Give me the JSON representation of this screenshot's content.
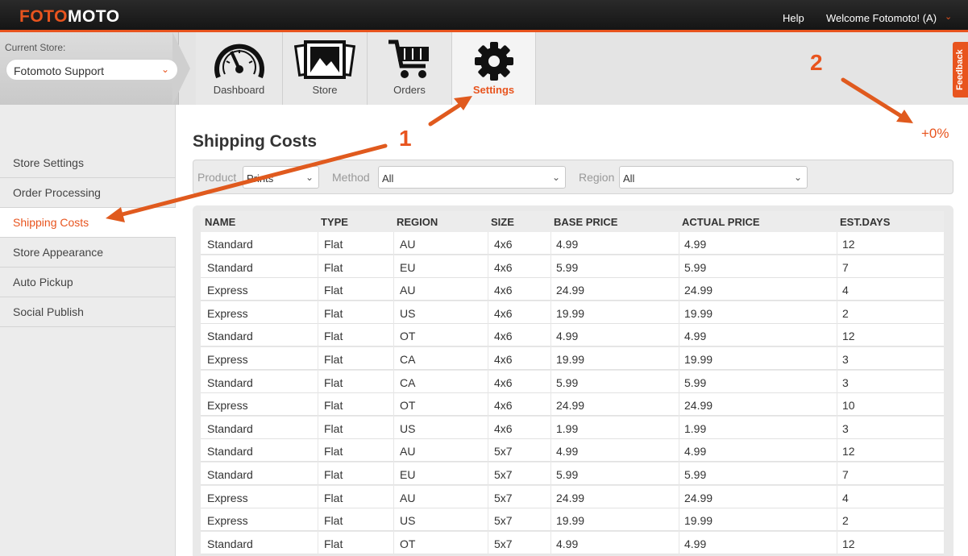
{
  "brand": {
    "logo_part1": "FOTO",
    "logo_part2": "MOTO",
    "accent": "#e8541e"
  },
  "topnav": {
    "help": "Help",
    "welcome": "Welcome Fotomoto! (A)"
  },
  "store": {
    "label": "Current Store:",
    "selected": "Fotomoto Support"
  },
  "tabs": [
    {
      "label": "Dashboard",
      "icon": "dashboard-gauge-icon"
    },
    {
      "label": "Store",
      "icon": "photos-icon"
    },
    {
      "label": "Orders",
      "icon": "cart-icon"
    },
    {
      "label": "Settings",
      "icon": "gear-icon",
      "active": true
    }
  ],
  "feedback": "Feedback",
  "sidebar": {
    "items": [
      {
        "label": "Store Settings"
      },
      {
        "label": "Order Processing"
      },
      {
        "label": "Shipping Costs",
        "active": true
      },
      {
        "label": "Store Appearance"
      },
      {
        "label": "Auto Pickup"
      },
      {
        "label": "Social Publish"
      }
    ]
  },
  "page": {
    "title": "Shipping Costs",
    "markup": "+0%"
  },
  "filters": {
    "product_label": "Product",
    "product_value": "Prints",
    "method_label": "Method",
    "method_value": "All",
    "region_label": "Region",
    "region_value": "All"
  },
  "table": {
    "headers": [
      "NAME",
      "TYPE",
      "REGION",
      "SIZE",
      "BASE PRICE",
      "ACTUAL PRICE",
      "EST.DAYS"
    ],
    "rows": [
      [
        "Standard",
        "Flat",
        "AU",
        "4x6",
        "4.99",
        "4.99",
        "12"
      ],
      [
        "Standard",
        "Flat",
        "EU",
        "4x6",
        "5.99",
        "5.99",
        "7"
      ],
      [
        "Express",
        "Flat",
        "AU",
        "4x6",
        "24.99",
        "24.99",
        "4"
      ],
      [
        "Express",
        "Flat",
        "US",
        "4x6",
        "19.99",
        "19.99",
        "2"
      ],
      [
        "Standard",
        "Flat",
        "OT",
        "4x6",
        "4.99",
        "4.99",
        "12"
      ],
      [
        "Express",
        "Flat",
        "CA",
        "4x6",
        "19.99",
        "19.99",
        "3"
      ],
      [
        "Standard",
        "Flat",
        "CA",
        "4x6",
        "5.99",
        "5.99",
        "3"
      ],
      [
        "Express",
        "Flat",
        "OT",
        "4x6",
        "24.99",
        "24.99",
        "10"
      ],
      [
        "Standard",
        "Flat",
        "US",
        "4x6",
        "1.99",
        "1.99",
        "3"
      ],
      [
        "Standard",
        "Flat",
        "AU",
        "5x7",
        "4.99",
        "4.99",
        "12"
      ],
      [
        "Standard",
        "Flat",
        "EU",
        "5x7",
        "5.99",
        "5.99",
        "7"
      ],
      [
        "Express",
        "Flat",
        "AU",
        "5x7",
        "24.99",
        "24.99",
        "4"
      ],
      [
        "Express",
        "Flat",
        "US",
        "5x7",
        "19.99",
        "19.99",
        "2"
      ],
      [
        "Standard",
        "Flat",
        "OT",
        "5x7",
        "4.99",
        "4.99",
        "12"
      ]
    ]
  },
  "annotations": {
    "one": "1",
    "two": "2"
  }
}
